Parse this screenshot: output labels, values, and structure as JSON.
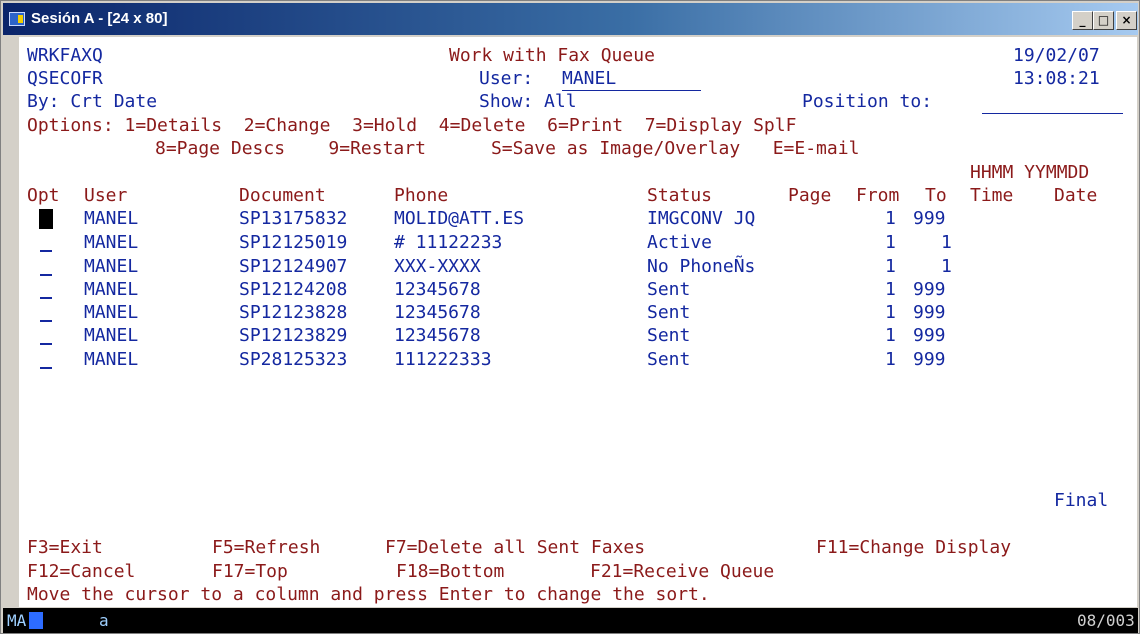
{
  "window": {
    "title": "Sesión A - [24 x 80]",
    "min_symbol": "_",
    "max_symbol": "□",
    "close_symbol": "×"
  },
  "header": {
    "program": "WRKFAXQ",
    "title": "Work with Fax Queue",
    "date": "19/02/07",
    "profile": "QSECOFR",
    "user_label": "User:",
    "user_value": "MANEL",
    "time": "13:08:21",
    "sort_label": "By: Crt Date",
    "show_label": "Show: All",
    "position_label": "Position to:",
    "position_value": ""
  },
  "options": {
    "line1": "Options: 1=Details  2=Change  3=Hold  4=Delete  6=Print  7=Display SplF",
    "line2": "8=Page Descs    9=Restart      S=Save as Image/Overlay   E=E-mail",
    "line3": "HHMM YYMMDD"
  },
  "columns": {
    "opt": "Opt",
    "user": "User",
    "document": "Document",
    "phone": "Phone",
    "status": "Status",
    "page": "Page",
    "from": "From",
    "to": "To",
    "time": "Time",
    "date": "Date"
  },
  "rows": [
    {
      "user": "MANEL",
      "document": "SP13175832",
      "phone": "MOLID@ATT.ES",
      "status": "IMGCONV JQ",
      "from": "1",
      "to": "999"
    },
    {
      "user": "MANEL",
      "document": "SP12125019",
      "phone": "# 11122233",
      "status": "Active",
      "from": "1",
      "to": "1"
    },
    {
      "user": "MANEL",
      "document": "SP12124907",
      "phone": "XXX-XXXX",
      "status": "No PhoneÑs",
      "from": "1",
      "to": "1"
    },
    {
      "user": "MANEL",
      "document": "SP12124208",
      "phone": "12345678",
      "status": "Sent",
      "from": "1",
      "to": "999"
    },
    {
      "user": "MANEL",
      "document": "SP12123828",
      "phone": "12345678",
      "status": "Sent",
      "from": "1",
      "to": "999"
    },
    {
      "user": "MANEL",
      "document": "SP12123829",
      "phone": "12345678",
      "status": "Sent",
      "from": "1",
      "to": "999"
    },
    {
      "user": "MANEL",
      "document": "SP28125323",
      "phone": "111222333",
      "status": "Sent",
      "from": "1",
      "to": "999"
    }
  ],
  "list_end": "Final",
  "fkeys": {
    "f3": "F3=Exit",
    "f5": "F5=Refresh",
    "f7": "F7=Delete all Sent Faxes",
    "f11": "F11=Change Display",
    "f12": "F12=Cancel",
    "f17": "F17=Top",
    "f18": "F18=Bottom",
    "f21": "F21=Receive Queue"
  },
  "message": "Move the cursor to a column and press Enter to change the sort.",
  "status": {
    "left": "MA",
    "mode": "a",
    "cursor_pos": "08/003"
  }
}
